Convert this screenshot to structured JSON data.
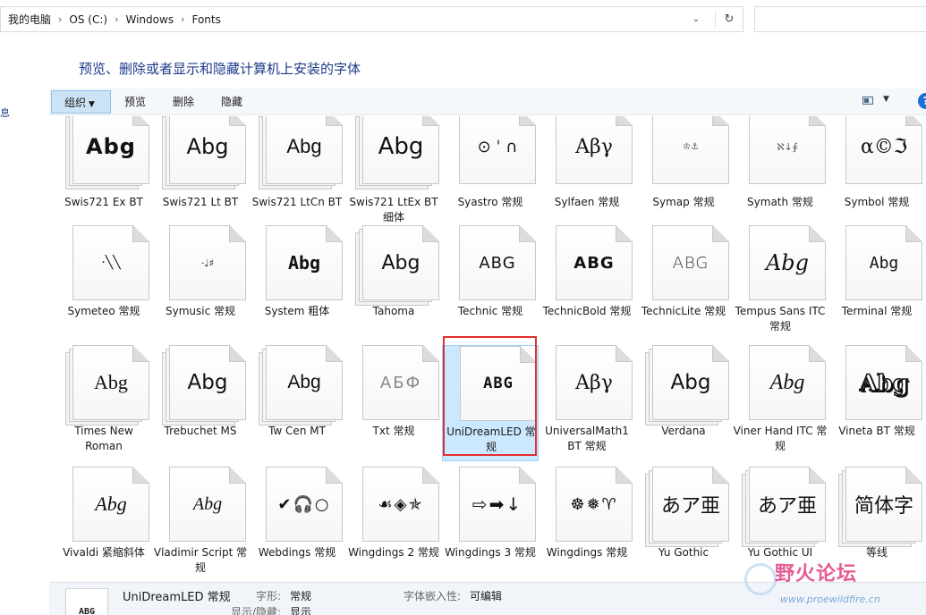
{
  "address": {
    "crumbs": [
      "我的电脑",
      "OS (C:)",
      "Windows",
      "Fonts"
    ]
  },
  "heading": "预览、删除或者显示和隐藏计算机上安装的字体",
  "left_nav_fragment": "息",
  "toolbar": {
    "organize": "组织",
    "preview": "预览",
    "delete": "删除",
    "hide": "隐藏"
  },
  "fonts": [
    {
      "label": "Swis721 Ex BT",
      "sample": "Abg",
      "stack": true
    },
    {
      "label": "Swis721 Lt BT",
      "sample": "Abg",
      "stack": true
    },
    {
      "label": "Swis721 LtCn BT",
      "sample": "Abg",
      "stack": true
    },
    {
      "label": "Swis721 LtEx BT 细体",
      "sample": "Abg",
      "stack": true
    },
    {
      "label": "Syastro 常规",
      "sample": "⊙ ˈ ∩",
      "stack": false
    },
    {
      "label": "Sylfaen 常规",
      "sample": "Αβγ",
      "stack": false
    },
    {
      "label": "Symap 常规",
      "sample": "♔⚓",
      "stack": false
    },
    {
      "label": "Symath 常规",
      "sample": "ℵ↓∮",
      "stack": false
    },
    {
      "label": "Symbol 常规",
      "sample": "α©ℑ",
      "stack": false
    },
    {
      "label": "Symeteo 常规",
      "sample": "·╲╲",
      "stack": false
    },
    {
      "label": "Symusic 常规",
      "sample": "·♩♯",
      "stack": false
    },
    {
      "label": "System 粗体",
      "sample": "Abg",
      "stack": false
    },
    {
      "label": "Tahoma",
      "sample": "Abg",
      "stack": true
    },
    {
      "label": "Technic 常规",
      "sample": "ABG",
      "stack": false
    },
    {
      "label": "TechnicBold 常规",
      "sample": "ABG",
      "stack": false
    },
    {
      "label": "TechnicLite 常规",
      "sample": "ABG",
      "stack": false
    },
    {
      "label": "Tempus Sans ITC 常规",
      "sample": "Abg",
      "stack": false
    },
    {
      "label": "Terminal 常规",
      "sample": "Abg",
      "stack": false
    },
    {
      "label": "Times New Roman",
      "sample": "Abg",
      "stack": true
    },
    {
      "label": "Trebuchet MS",
      "sample": "Abg",
      "stack": true
    },
    {
      "label": "Tw Cen MT",
      "sample": "Abg",
      "stack": true
    },
    {
      "label": "Txt 常规",
      "sample": "АБФ",
      "stack": false
    },
    {
      "label": "UniDreamLED 常规",
      "sample": "ABG",
      "stack": false,
      "selected": true
    },
    {
      "label": "UniversalMath1 BT 常规",
      "sample": "Αβγ",
      "stack": false
    },
    {
      "label": "Verdana",
      "sample": "Abg",
      "stack": true
    },
    {
      "label": "Viner Hand ITC 常规",
      "sample": "Abg",
      "stack": false
    },
    {
      "label": "Vineta BT 常规",
      "sample": "Abg",
      "stack": false
    },
    {
      "label": "Vivaldi 紧缩斜体",
      "sample": "Abg",
      "stack": false
    },
    {
      "label": "Vladimir Script 常规",
      "sample": "Abg",
      "stack": false
    },
    {
      "label": "Webdings 常规",
      "sample": "✔🎧○",
      "stack": false
    },
    {
      "label": "Wingdings 2 常规",
      "sample": "☙◈✯",
      "stack": false
    },
    {
      "label": "Wingdings 3 常规",
      "sample": "⇨➡↓",
      "stack": false
    },
    {
      "label": "Wingdings 常规",
      "sample": "☸❅♈",
      "stack": false
    },
    {
      "label": "Yu Gothic",
      "sample": "あア亜",
      "stack": true
    },
    {
      "label": "Yu Gothic UI",
      "sample": "あア亜",
      "stack": true
    },
    {
      "label": "等线",
      "sample": "简体字",
      "stack": true
    }
  ],
  "details": {
    "thumb": "ABG",
    "name": "UniDreamLED 常规",
    "style_key": "字形:",
    "style_val": "常规",
    "embed_key": "字体嵌入性:",
    "embed_val": "可编辑",
    "show_key": "显示/隐藏:",
    "show_val": "显示"
  },
  "watermark": {
    "title": "野火论坛",
    "url": "www.proewildfire.cn"
  },
  "colors": {
    "accent": "#1a6ed8",
    "selection": "#cce8ff",
    "highlight_box": "#e23030"
  }
}
